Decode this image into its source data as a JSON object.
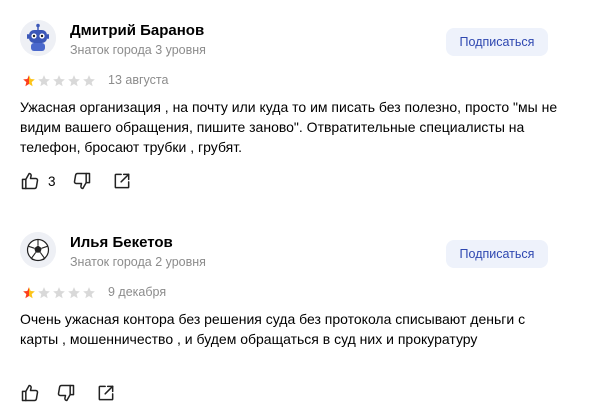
{
  "reviews": [
    {
      "author": "Дмитрий Баранов",
      "level": "Знаток города 3 уровня",
      "subscribe_label": "Подписаться",
      "rating": 1,
      "date": "13 августа",
      "text": "Ужасная организация , на почту или куда то им писать без полезно, просто \"мы не видим вашего обращения, пишите заново\". Отвратительные специалисты на телефон, бросают трубки , грубят.",
      "likes": "3",
      "avatar_icon": "robot-icon"
    },
    {
      "author": "Илья Бекетов",
      "level": "Знаток города 2 уровня",
      "subscribe_label": "Подписаться",
      "rating": 1,
      "date": "9 декабря",
      "text": "Очень ужасная контора без решения суда без протокола списывают деньги с карты , мошенничество , и будем обращаться в суд них и прокуратуру",
      "likes": "",
      "avatar_icon": "soccer-ball-icon"
    }
  ],
  "colors": {
    "star_filled": "#fc3f1d",
    "star_half": "#fcc419",
    "star_empty": "#d9d9d9",
    "subscribe_bg": "#eef2fb",
    "subscribe_text": "#2e47b0",
    "muted_text": "#8c8c8c"
  }
}
